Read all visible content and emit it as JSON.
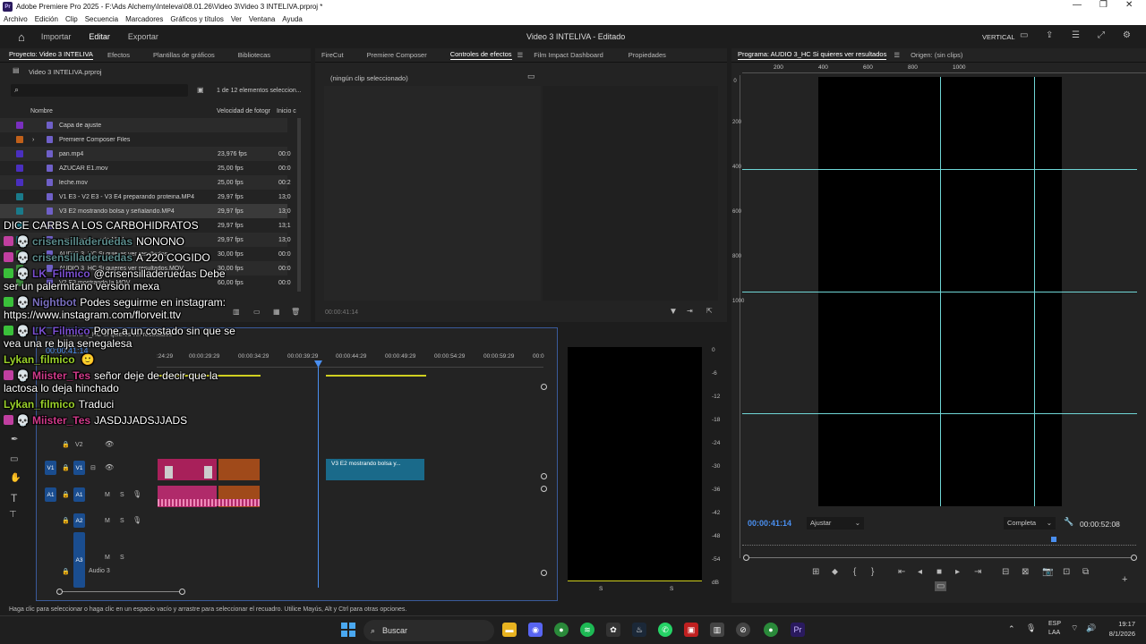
{
  "window": {
    "title": "Adobe Premiere Pro 2025 - F:\\Ads Alchemy\\Inteleva\\08.01.26\\Video 3\\Video 3 INTELIVA.prproj *"
  },
  "menu": [
    "Archivo",
    "Edición",
    "Clip",
    "Secuencia",
    "Marcadores",
    "Gráficos y títulos",
    "Ver",
    "Ventana",
    "Ayuda"
  ],
  "appbar": {
    "tabs": [
      "Importar",
      "Editar",
      "Exportar"
    ],
    "project_title": "Video 3 INTELIVA - Editado",
    "layout": "VERTICAL"
  },
  "project": {
    "tabs": [
      "Proyecto: Video 3 INTELIVA",
      "Efectos",
      "Plantillas de gráficos",
      "Bibliotecas"
    ],
    "file": "Video 3 INTELIVA.prproj",
    "search_placeholder": "",
    "count": "1 de 12 elementos seleccion...",
    "columns": [
      "Nombre",
      "Velocidad de fotogr",
      "Inicio c"
    ],
    "items": [
      {
        "name": "Capa de ajuste",
        "fps": "",
        "start": "",
        "color": "#7a2fbf"
      },
      {
        "name": "Premiere Composer Files",
        "fps": "",
        "start": "",
        "color": "#c0601a"
      },
      {
        "name": "pan.mp4",
        "fps": "23,976 fps",
        "start": "00:0",
        "color": "#4a2fbf"
      },
      {
        "name": "AZUCAR E1.mov",
        "fps": "25,00 fps",
        "start": "00:0",
        "color": "#4a2fbf"
      },
      {
        "name": "leche.mov",
        "fps": "25,00 fps",
        "start": "00:2",
        "color": "#4a2fbf"
      },
      {
        "name": "V1 E3 - V2 E3 - V3 E4 preparando proteina.MP4",
        "fps": "29,97 fps",
        "start": "13;0",
        "color": "#1a7a8a"
      },
      {
        "name": "V3 E2 mostrando bolsa  y señalando.MP4",
        "fps": "29,97 fps",
        "start": "13;0",
        "color": "#1a7a8a"
      },
      {
        "name": "",
        "fps": "29,97 fps",
        "start": "13;1",
        "color": "#1a7a8a"
      },
      {
        "name": "...mostrando...ado.MP4",
        "fps": "29,97 fps",
        "start": "13;0",
        "color": "#1a7a8a"
      },
      {
        "name": "AUDIO 3_HC Si quieres ver resultados",
        "fps": "30,00 fps",
        "start": "00:0",
        "color": "#3a8a3a"
      },
      {
        "name": "AUDIO 3_HC Si quieres ver resultados.MOV",
        "fps": "30,00 fps",
        "start": "00:0",
        "color": "#3a8a3a"
      },
      {
        "name": "V2 E3 mostrando la MOV",
        "fps": "60,00 fps",
        "start": "00:0",
        "color": "#3a8a3a"
      }
    ]
  },
  "effects": {
    "tabs": [
      "FireCut",
      "Premiere Composer",
      "Controles de efectos",
      "Film Impact Dashboard",
      "Propiedades"
    ],
    "empty_msg": "(ningún clip seleccionado)",
    "timecode": "00:00:41:14"
  },
  "program": {
    "tab": "Programa: AUDIO 3_HC Si quieres ver resultados",
    "source_tab": "Origen: (sin clips)",
    "ruler": [
      "200",
      "400",
      "600",
      "800",
      "1000"
    ],
    "left_ruler": [
      "0",
      "200",
      "400",
      "600",
      "800",
      "1000"
    ],
    "timecode": "00:00:41:14",
    "fit": "Ajustar",
    "quality": "Completa",
    "duration": "00:00:52:08"
  },
  "timeline": {
    "tab": "AUDIO 3_HC Si quieres ver resultados",
    "timecode": "00:00:41:14",
    "ruler": [
      ":24:29",
      "00:00:29:29",
      "00:00:34:29",
      "00:00:39:29",
      "00:00:44:29",
      "00:00:49:29",
      "00:00:54:29",
      "00:00:59:29",
      "00:0"
    ],
    "tracks": {
      "v2": "V2",
      "v1": "V1",
      "a1": "A1",
      "a2": "A2",
      "a3": "A3",
      "audio3_name": "Audio 3"
    },
    "clip_label": "V3 E2 mostrando bolsa  y..."
  },
  "meter": {
    "scale": [
      "0",
      "-6",
      "-12",
      "-18",
      "-24",
      "-30",
      "-36",
      "-42",
      "-48",
      "-54",
      "dB"
    ],
    "channels": [
      "S",
      "S"
    ]
  },
  "status": "Haga clic para seleccionar o haga clic en un espacio vacío y arrastre para seleccionar el recuadro. Utilice Mayús, Alt y Ctrl para otras opciones.",
  "chat": [
    {
      "user": "",
      "text": "DICE CARBS A LOS CARBOHIDRATOS",
      "color": "#ffffff",
      "badge": ""
    },
    {
      "user": "crisensilladeruedas",
      "text": "NONONO",
      "color": "#5a8a8a",
      "badge": "#c03fa0"
    },
    {
      "user": "crisensilladeruedas",
      "text": "A 220 COGIDO",
      "color": "#5a8a8a",
      "badge": "#c03fa0"
    },
    {
      "user": "LK_Filmico",
      "text": "@crisensilladeruedas Debe",
      "color": "#7a4fd0",
      "badge": "#3ac03a"
    },
    {
      "user": "",
      "text": "ser un palermitano version mexa",
      "color": "#ffffff",
      "badge": ""
    },
    {
      "user": "Nightbot",
      "text": "Podes seguirme en instagram:",
      "color": "#7a6fc0",
      "badge": "#3ac03a"
    },
    {
      "user": "",
      "text": "https://www.instagram.com/florveit.ttv",
      "color": "#ffffff",
      "badge": ""
    },
    {
      "user": "LK_Filmico",
      "text": "Pone a un costado sin que se",
      "color": "#7a4fd0",
      "badge": "#3ac03a"
    },
    {
      "user": "",
      "text": "vea una re bija senegalesa",
      "color": "#ffffff",
      "badge": ""
    },
    {
      "user": "Lykan_filmico",
      "text": "",
      "color": "#9ad02a",
      "badge": ""
    },
    {
      "user": "Miister_Tes",
      "text": "señor deje de decir que la",
      "color": "#d03a8a",
      "badge": "#c03fa0"
    },
    {
      "user": "",
      "text": "lactosa lo deja hinchado",
      "color": "#ffffff",
      "badge": ""
    },
    {
      "user": "Lykan_filmico",
      "text": "Traduci",
      "color": "#9ad02a",
      "badge": ""
    },
    {
      "user": "Miister_Tes",
      "text": "JASDJJADSJJADS",
      "color": "#d03a8a",
      "badge": "#c03fa0"
    }
  ],
  "taskbar": {
    "search": "Buscar",
    "lang": "ESP",
    "lang2": "LAA",
    "time": "19:17",
    "date": "8/1/2026"
  }
}
